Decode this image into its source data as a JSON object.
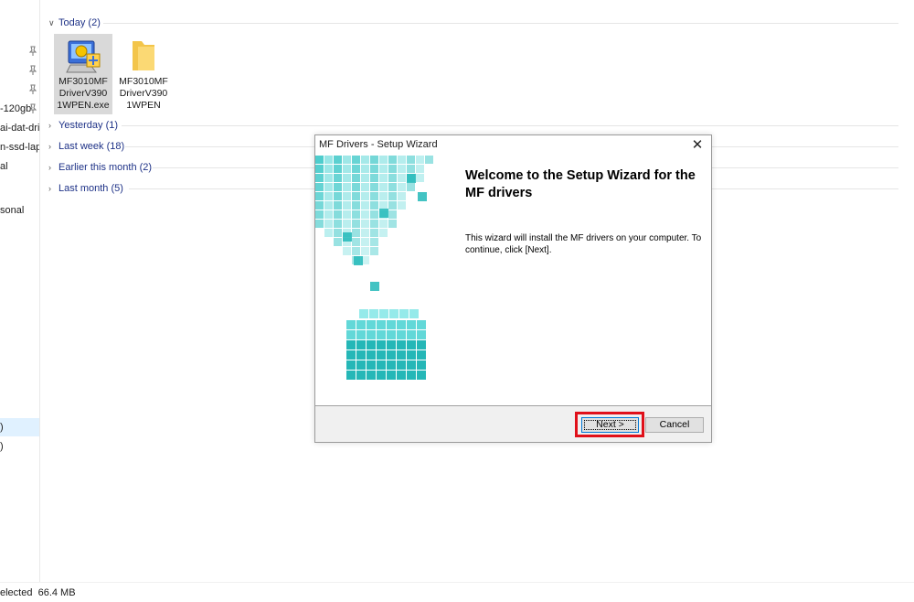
{
  "nav": {
    "items": [
      {
        "label": "-120gb"
      },
      {
        "label": "ai-dat-dri"
      },
      {
        "label": "n-ssd-lapt"
      },
      {
        "label": "al"
      },
      {
        "label": "sonal"
      },
      {
        "label": ")"
      },
      {
        "label": ")"
      }
    ]
  },
  "groups": [
    {
      "label": "Today (2)"
    },
    {
      "label": "Yesterday (1)"
    },
    {
      "label": "Last week (18)"
    },
    {
      "label": "Earlier this month (2)"
    },
    {
      "label": "Last month (5)"
    }
  ],
  "files": [
    {
      "label": "MF3010MF DriverV390 1WPEN.exe",
      "line1": "MF3010MF",
      "line2": "DriverV390",
      "line3": "1WPEN.exe",
      "icon": "installer-icon"
    },
    {
      "label": "MF3010MF DriverV390 1WPEN",
      "line1": "MF3010MF",
      "line2": "DriverV390",
      "line3": "1WPEN",
      "icon": "folder-icon"
    }
  ],
  "status": {
    "text": "elected  66.4 MB"
  },
  "dialog": {
    "title": "MF Drivers - Setup Wizard",
    "close_label": "✕",
    "heading": "Welcome to the Setup Wizard for the MF drivers",
    "description": "This wizard will install the MF drivers on your computer. To continue, click [Next].",
    "next_label": "Next >",
    "cancel_label": "Cancel"
  },
  "colors": {
    "highlight": "#e0101a",
    "group_text": "#1e3287",
    "art_cyan": "#26c6c6"
  }
}
